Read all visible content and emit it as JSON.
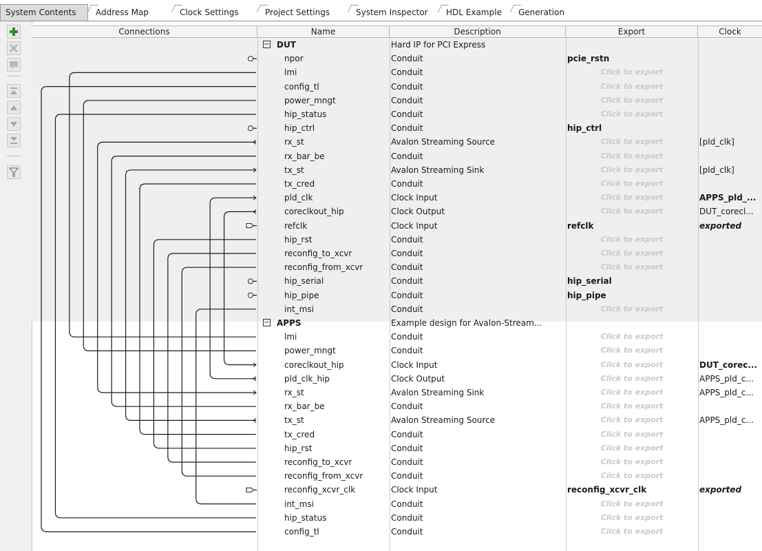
{
  "tabs": [
    {
      "label": "System Contents",
      "active": true
    },
    {
      "label": "Address Map",
      "active": false
    },
    {
      "label": "Clock Settings",
      "active": false
    },
    {
      "label": "Project Settings",
      "active": false
    },
    {
      "label": "System Inspector",
      "active": false
    },
    {
      "label": "HDL Example",
      "active": false
    },
    {
      "label": "Generation",
      "active": false
    }
  ],
  "toolbar": {
    "buttons": [
      {
        "icon": "add-icon"
      },
      {
        "icon": "remove-icon"
      },
      {
        "icon": "edit-icon"
      },
      {
        "icon": "move-top-icon"
      },
      {
        "icon": "move-up-icon"
      },
      {
        "icon": "move-down-icon"
      },
      {
        "icon": "move-bottom-icon"
      },
      {
        "icon": "filter-icon"
      }
    ]
  },
  "table": {
    "headers": {
      "connections": "Connections",
      "name": "Name",
      "description": "Description",
      "export": "Export",
      "clock": "Clock"
    },
    "click_to_export": "Click to export",
    "rows": [
      {
        "name": "DUT",
        "desc": "Hard IP for PCI Express",
        "export": "",
        "clock": "",
        "component": true
      },
      {
        "name": "npor",
        "desc": "Conduit",
        "export": "pcie_rstn",
        "clock": "",
        "marker": "o"
      },
      {
        "name": "lmi",
        "desc": "Conduit",
        "export": "",
        "clock": ""
      },
      {
        "name": "config_tl",
        "desc": "Conduit",
        "export": "",
        "clock": ""
      },
      {
        "name": "power_mngt",
        "desc": "Conduit",
        "export": "",
        "clock": ""
      },
      {
        "name": "hip_status",
        "desc": "Conduit",
        "export": "",
        "clock": ""
      },
      {
        "name": "hip_ctrl",
        "desc": "Conduit",
        "export": "hip_ctrl",
        "clock": "",
        "marker": "o"
      },
      {
        "name": "rx_st",
        "desc": "Avalon Streaming Source",
        "export": "",
        "clock": "[pld_clk]",
        "marker": "<"
      },
      {
        "name": "rx_bar_be",
        "desc": "Conduit",
        "export": "",
        "clock": ""
      },
      {
        "name": "tx_st",
        "desc": "Avalon Streaming Sink",
        "export": "",
        "clock": "[pld_clk]",
        "marker": ">"
      },
      {
        "name": "tx_cred",
        "desc": "Conduit",
        "export": "",
        "clock": ""
      },
      {
        "name": "pld_clk",
        "desc": "Clock Input",
        "export": "",
        "clock": "APPS_pld_...",
        "clockBold": true,
        "marker": ">"
      },
      {
        "name": "coreclkout_hip",
        "desc": "Clock Output",
        "export": "",
        "clock": "DUT_corecl...",
        "marker": "<"
      },
      {
        "name": "refclk",
        "desc": "Clock Input",
        "export": "refclk",
        "clock": "exported",
        "clockItalic": true,
        "marker": "D"
      },
      {
        "name": "hip_rst",
        "desc": "Conduit",
        "export": "",
        "clock": ""
      },
      {
        "name": "reconfig_to_xcvr",
        "desc": "Conduit",
        "export": "",
        "clock": ""
      },
      {
        "name": "reconfig_from_xcvr",
        "desc": "Conduit",
        "export": "",
        "clock": ""
      },
      {
        "name": "hip_serial",
        "desc": "Conduit",
        "export": "hip_serial",
        "clock": "",
        "marker": "o"
      },
      {
        "name": "hip_pipe",
        "desc": "Conduit",
        "export": "hip_pipe",
        "clock": "",
        "marker": "o"
      },
      {
        "name": "int_msi",
        "desc": "Conduit",
        "export": "",
        "clock": ""
      },
      {
        "name": "APPS",
        "desc": "Example design for Avalon-Stream...",
        "export": "",
        "clock": "",
        "component": true
      },
      {
        "name": "lmi",
        "desc": "Conduit",
        "export": "",
        "clock": ""
      },
      {
        "name": "power_mngt",
        "desc": "Conduit",
        "export": "",
        "clock": ""
      },
      {
        "name": "coreclkout_hip",
        "desc": "Clock Input",
        "export": "",
        "clock": "DUT_corec...",
        "clockBold": true,
        "marker": ">"
      },
      {
        "name": "pld_clk_hip",
        "desc": "Clock Output",
        "export": "",
        "clock": "APPS_pld_c...",
        "marker": "<"
      },
      {
        "name": "rx_st",
        "desc": "Avalon Streaming Sink",
        "export": "",
        "clock": "APPS_pld_c...",
        "marker": ">"
      },
      {
        "name": "rx_bar_be",
        "desc": "Conduit",
        "export": "",
        "clock": ""
      },
      {
        "name": "tx_st",
        "desc": "Avalon Streaming Source",
        "export": "",
        "clock": "APPS_pld_c...",
        "marker": "<"
      },
      {
        "name": "tx_cred",
        "desc": "Conduit",
        "export": "",
        "clock": ""
      },
      {
        "name": "hip_rst",
        "desc": "Conduit",
        "export": "",
        "clock": ""
      },
      {
        "name": "reconfig_to_xcvr",
        "desc": "Conduit",
        "export": "",
        "clock": ""
      },
      {
        "name": "reconfig_from_xcvr",
        "desc": "Conduit",
        "export": "",
        "clock": ""
      },
      {
        "name": "reconfig_xcvr_clk",
        "desc": "Clock Input",
        "export": "reconfig_xcvr_clk",
        "clock": "exported",
        "clockItalic": true,
        "marker": "D"
      },
      {
        "name": "int_msi",
        "desc": "Conduit",
        "export": "",
        "clock": ""
      },
      {
        "name": "hip_status",
        "desc": "Conduit",
        "export": "",
        "clock": ""
      },
      {
        "name": "config_tl",
        "desc": "Conduit",
        "export": "",
        "clock": ""
      }
    ],
    "connections": [
      [
        2,
        21
      ],
      [
        3,
        35
      ],
      [
        4,
        22
      ],
      [
        5,
        34
      ],
      [
        7,
        25
      ],
      [
        8,
        26
      ],
      [
        9,
        27
      ],
      [
        10,
        28
      ],
      [
        11,
        24
      ],
      [
        12,
        23
      ],
      [
        14,
        29
      ],
      [
        15,
        30
      ],
      [
        16,
        31
      ],
      [
        19,
        33
      ]
    ]
  }
}
